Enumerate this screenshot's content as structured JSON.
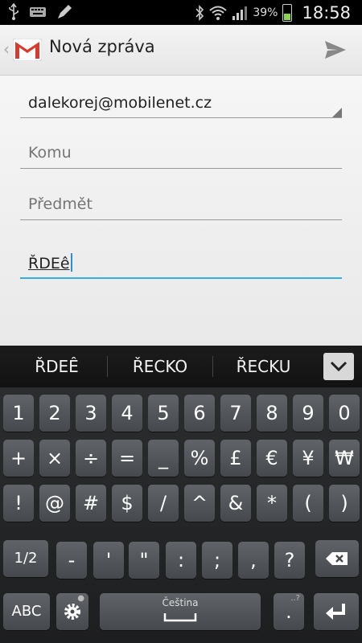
{
  "status_bar": {
    "battery_percent": "39%",
    "time": "18:58",
    "icons": [
      "usb-icon",
      "keyboard-icon",
      "pen-icon",
      "bluetooth-icon",
      "wifi-icon",
      "signal-icon",
      "battery-icon"
    ]
  },
  "action_bar": {
    "title": "Nová zpráva",
    "icons": [
      "back-chevron-icon",
      "gmail-icon",
      "send-icon"
    ]
  },
  "compose": {
    "from": "dalekorej@mobilenet.cz",
    "to_placeholder": "Komu",
    "subject_placeholder": "Předmět",
    "body_text": "ŘDEê"
  },
  "suggestions": [
    "ŘDEÊ",
    "ŘECKO",
    "ŘECKU"
  ],
  "keyboard": {
    "row1": [
      "1",
      "2",
      "3",
      "4",
      "5",
      "6",
      "7",
      "8",
      "9",
      "0"
    ],
    "row2": [
      "+",
      "×",
      "÷",
      "=",
      "_",
      "%",
      "£",
      "€",
      "¥",
      "₩"
    ],
    "row3": [
      "!",
      "@",
      "#",
      "$",
      "/",
      "^",
      "&",
      "*",
      "(",
      ")"
    ],
    "row4": [
      "1/2",
      "-",
      "'",
      "\"",
      ":",
      ";",
      ",",
      "?"
    ],
    "abc_label": "ABC",
    "space_label": "Čeština",
    "period_label": ".",
    "period_hint": "..?",
    "colors": {
      "key": "#55595d",
      "accent": "#33aee0",
      "cursor": "#2a8fd6"
    }
  }
}
